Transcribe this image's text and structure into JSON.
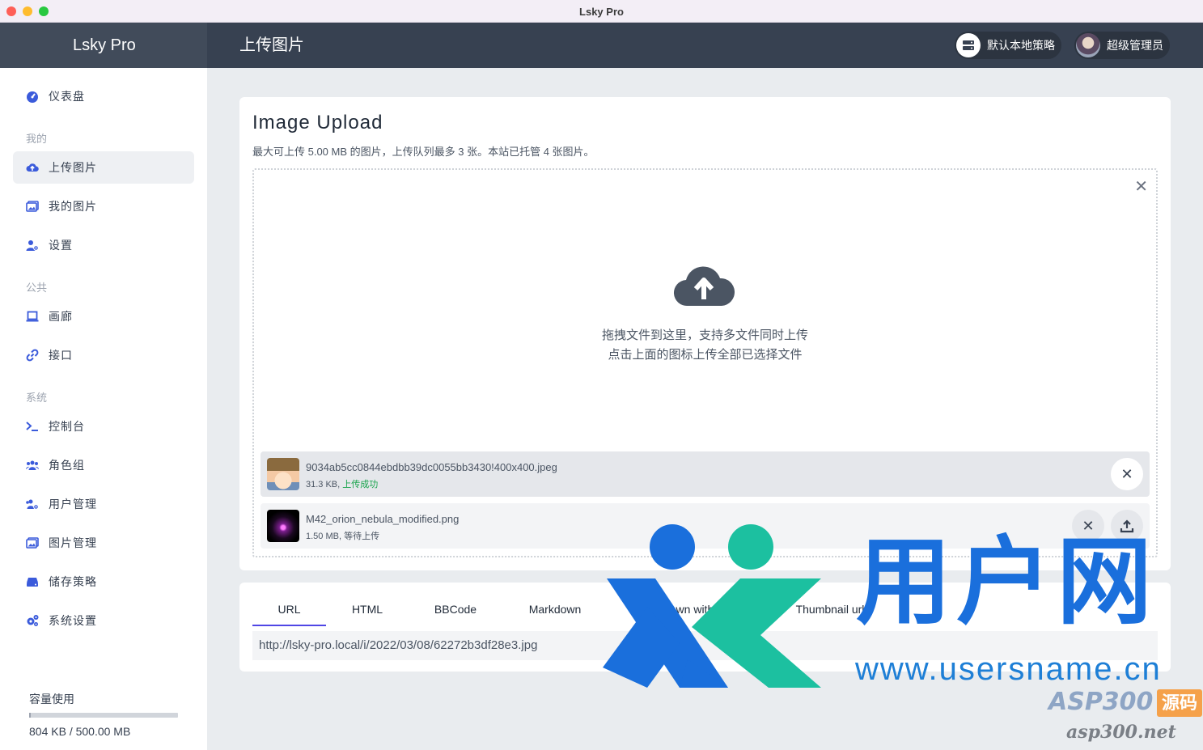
{
  "window": {
    "title": "Lsky Pro"
  },
  "header": {
    "brand": "Lsky Pro",
    "page_title": "上传图片",
    "storage_strategy": "默认本地策略",
    "user_name": "超级管理员"
  },
  "sidebar": {
    "dashboard": "仪表盘",
    "section_mine": "我的",
    "upload": "上传图片",
    "my_images": "我的图片",
    "settings": "设置",
    "section_public": "公共",
    "gallery": "画廊",
    "api": "接口",
    "section_system": "系统",
    "console": "控制台",
    "roles": "角色组",
    "users": "用户管理",
    "images": "图片管理",
    "storage": "储存策略",
    "system_settings": "系统设置",
    "usage_title": "容量使用",
    "usage_text": "804 KB / 500.00 MB",
    "usage_fraction": 0.0016
  },
  "upload": {
    "title": "Image Upload",
    "subtitle": "最大可上传 5.00 MB 的图片，上传队列最多 3 张。本站已托管 4 张图片。",
    "drop_line1": "拖拽文件到这里，支持多文件同时上传",
    "drop_line2": "点击上面的图标上传全部已选择文件",
    "files": [
      {
        "name": "9034ab5cc0844ebdbb39dc0055bb3430!400x400.jpeg",
        "size": "31.3 KB,",
        "status": "上传成功"
      },
      {
        "name": "M42_orion_nebula_modified.png",
        "size": "1.50 MB,",
        "status": "等待上传"
      }
    ]
  },
  "links": {
    "tabs": [
      "URL",
      "HTML",
      "BBCode",
      "Markdown",
      "Markdown with link",
      "Thumbnail url"
    ],
    "url_value": "http://lsky-pro.local/i/2022/03/08/62272b3df28e3.jpg"
  },
  "watermark": {
    "title": "用户网",
    "url": "www.usersname.cn",
    "asp": "ASP300",
    "asp_badge": "源码",
    "asp_url": "asp300.net"
  },
  "colors": {
    "header": "#374151",
    "accent": "#4f46e5",
    "success": "#16a34a",
    "watermark_blue": "#1a6fdc",
    "watermark_teal": "#1cc0a0"
  }
}
